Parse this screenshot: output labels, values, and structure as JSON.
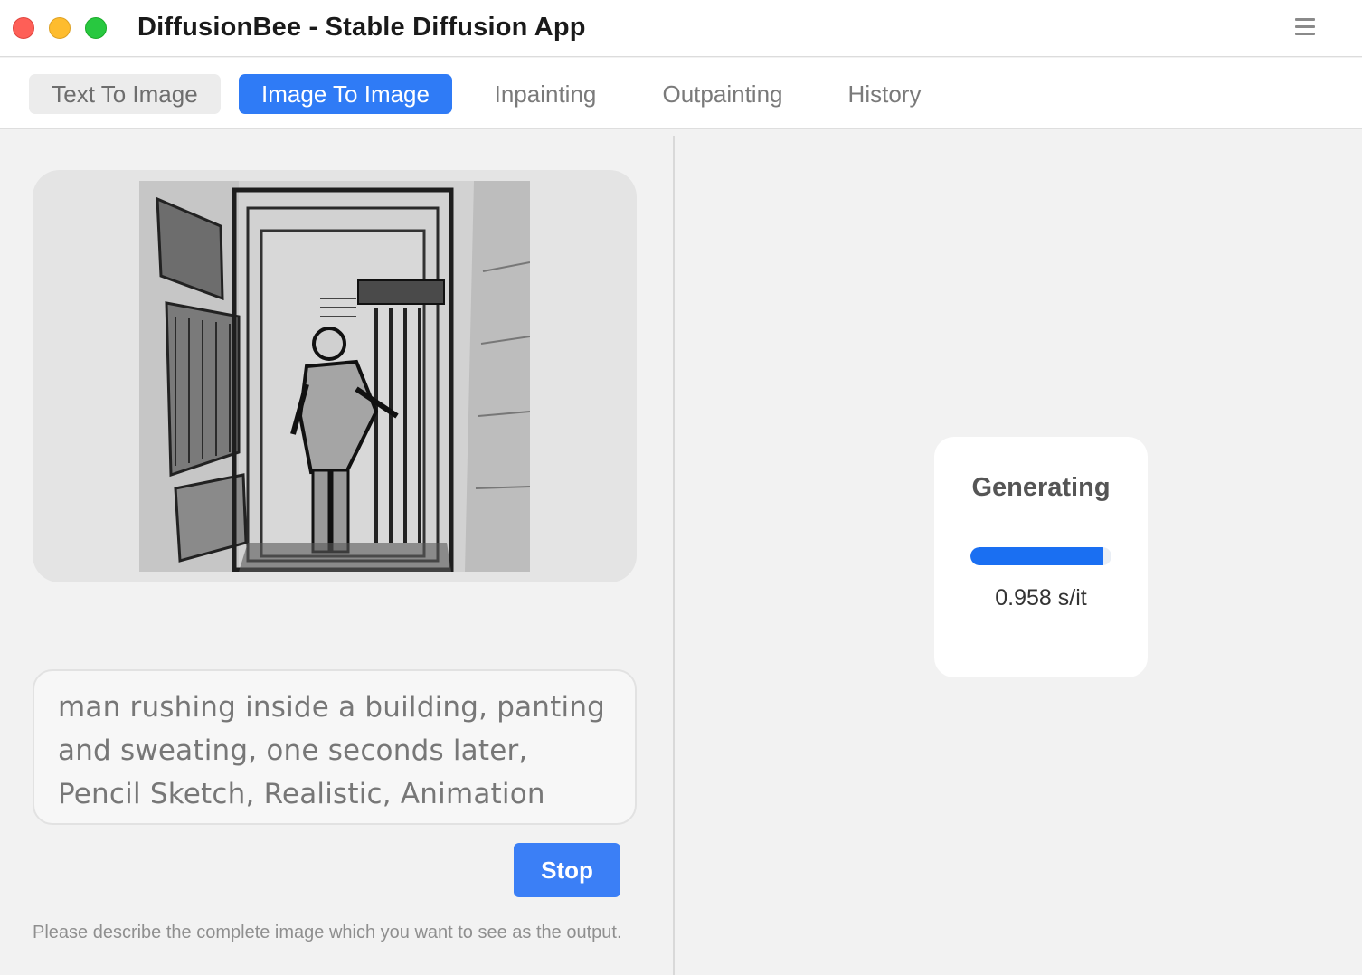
{
  "window": {
    "title": "DiffusionBee - Stable Diffusion App"
  },
  "tabs": [
    {
      "label": "Text To Image",
      "active": false
    },
    {
      "label": "Image To Image",
      "active": true
    },
    {
      "label": "Inpainting",
      "active": false
    },
    {
      "label": "Outpainting",
      "active": false
    },
    {
      "label": "History",
      "active": false
    }
  ],
  "input_image": {
    "description": "pencil sketch"
  },
  "prompt": {
    "value": "man rushing inside a building, panting and sweating, one seconds later, Pencil Sketch, Realistic, Animation"
  },
  "stop_button": {
    "label": "Stop"
  },
  "hint": {
    "text": "Please describe the complete image which you want to see as the output."
  },
  "generation": {
    "status": "Generating",
    "progress": 0.94,
    "speed": "0.958 s/it"
  },
  "colors": {
    "accent": "#2f7bf6",
    "progress": "#1a6ff2",
    "close": "#fe5f57",
    "minimize": "#febc2e",
    "maximize": "#28c840"
  },
  "icons": {
    "menu": "hamburger-menu-icon"
  }
}
